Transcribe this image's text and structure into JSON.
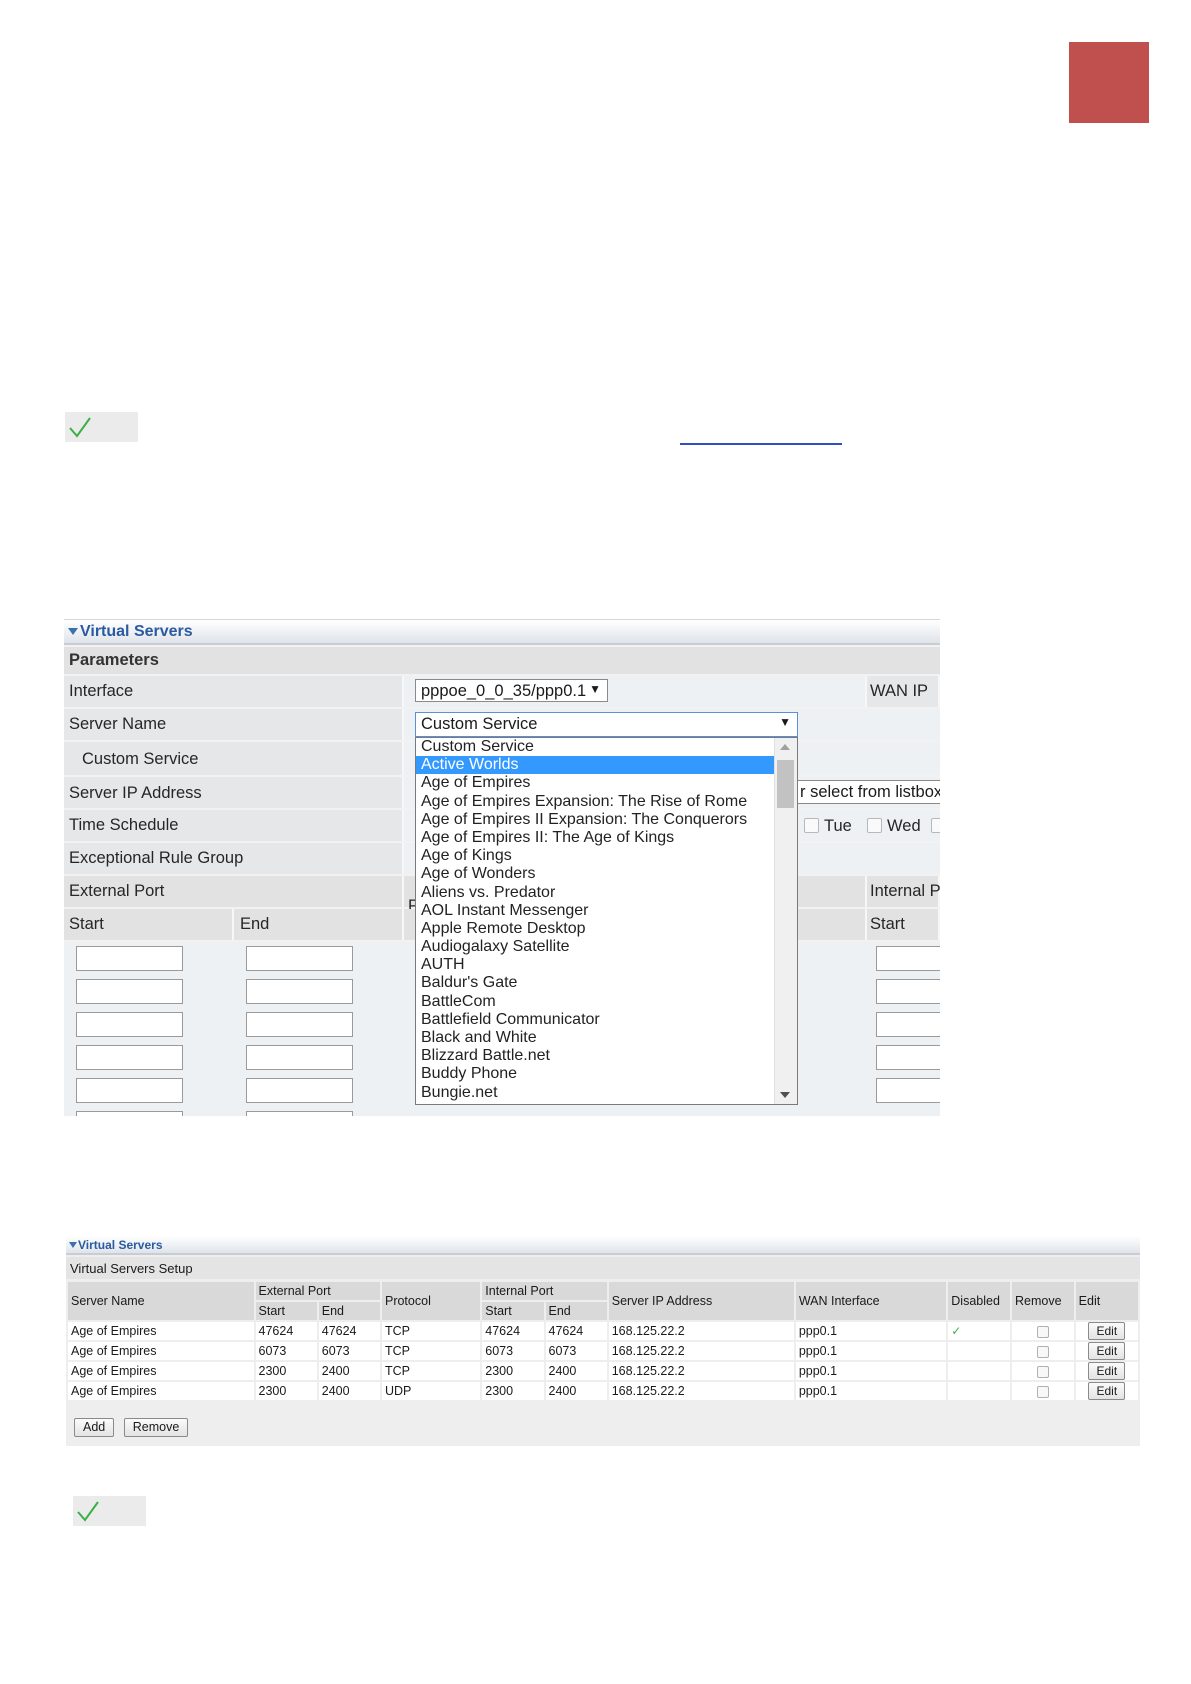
{
  "shot1": {
    "title": "Virtual Servers",
    "parameters_label": "Parameters",
    "interface_label": "Interface",
    "interface_value": "pppoe_0_0_35/ppp0.1",
    "wan_ip_label": "WAN IP",
    "server_name_label": "Server Name",
    "server_name_value": "Custom Service",
    "custom_service_label": "Custom Service",
    "server_ip_label": "Server IP Address",
    "server_ip_hint": "r select from listbox",
    "time_schedule_label": "Time Schedule",
    "day_tue": "Tue",
    "day_wed": "Wed",
    "exceptional_label": "Exceptional Rule Group",
    "external_port_label": "External Port",
    "internal_port_label": "Internal P",
    "partial_p": "P",
    "start_label": "Start",
    "end_label": "End",
    "internal_start_label": "Start",
    "dropdown_selected_index": 1,
    "dropdown_options": [
      "Custom Service",
      "Active Worlds",
      "Age of Empires",
      "Age of Empires Expansion: The Rise of Rome",
      "Age of Empires II Expansion: The Conquerors",
      "Age of Empires II: The Age of Kings",
      "Age of Kings",
      "Age of Wonders",
      "Aliens vs. Predator",
      "AOL Instant Messenger",
      "Apple Remote Desktop",
      "Audiogalaxy Satellite",
      "AUTH",
      "Baldur's Gate",
      "BattleCom",
      "Battlefield Communicator",
      "Black and White",
      "Blizzard Battle.net",
      "Buddy Phone",
      "Bungie.net"
    ]
  },
  "shot2": {
    "title": "Virtual Servers",
    "setup_label": "Virtual Servers Setup",
    "headers": {
      "server_name": "Server Name",
      "external_port": "External Port",
      "protocol": "Protocol",
      "internal_port": "Internal Port",
      "server_ip": "Server IP Address",
      "wan_interface": "WAN Interface",
      "disabled": "Disabled",
      "remove": "Remove",
      "edit": "Edit",
      "start": "Start",
      "end": "End"
    },
    "rows": [
      {
        "name": "Age of Empires",
        "ext_start": "47624",
        "ext_end": "47624",
        "protocol": "TCP",
        "int_start": "47624",
        "int_end": "47624",
        "ip": "168.125.22.2",
        "wan": "ppp0.1",
        "disabled": true,
        "edit": "Edit"
      },
      {
        "name": "Age of Empires",
        "ext_start": "6073",
        "ext_end": "6073",
        "protocol": "TCP",
        "int_start": "6073",
        "int_end": "6073",
        "ip": "168.125.22.2",
        "wan": "ppp0.1",
        "disabled": false,
        "edit": "Edit"
      },
      {
        "name": "Age of Empires",
        "ext_start": "2300",
        "ext_end": "2400",
        "protocol": "TCP",
        "int_start": "2300",
        "int_end": "2400",
        "ip": "168.125.22.2",
        "wan": "ppp0.1",
        "disabled": false,
        "edit": "Edit"
      },
      {
        "name": "Age of Empires",
        "ext_start": "2300",
        "ext_end": "2400",
        "protocol": "UDP",
        "int_start": "2300",
        "int_end": "2400",
        "ip": "168.125.22.2",
        "wan": "ppp0.1",
        "disabled": false,
        "edit": "Edit"
      }
    ],
    "add_label": "Add",
    "remove_label": "Remove"
  },
  "colors": {
    "corner_accent": "#c0504d",
    "header_text": "#2a5aa0",
    "selection": "#3399ff",
    "check": "#3cb043"
  }
}
